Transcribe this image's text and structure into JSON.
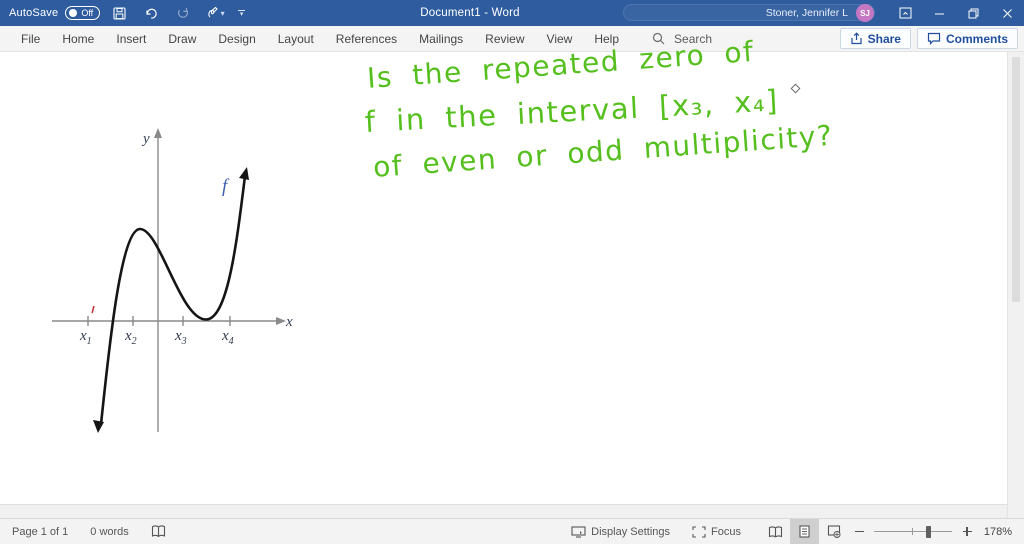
{
  "title_bar": {
    "autosave_label": "AutoSave",
    "autosave_state": "Off",
    "document_title": "Document1  -  Word",
    "user_name": "Stoner, Jennifer L",
    "user_initials": "SJ"
  },
  "ribbon": {
    "tabs": [
      "File",
      "Home",
      "Insert",
      "Draw",
      "Design",
      "Layout",
      "References",
      "Mailings",
      "Review",
      "View",
      "Help"
    ],
    "search_label": "Search",
    "share_label": "Share",
    "comments_label": "Comments"
  },
  "document": {
    "ink_lines": [
      "Is the repeated zero of",
      "f in the interval [x₃, x₄]",
      "of even or odd multiplicity?"
    ],
    "figure": {
      "description": "Graph of a polynomial f: rises from lower left crossing x-axis between x1 and x2, local maximum above x2, touches x-axis (repeated zero) between x3 and x4, then rises steeply",
      "y_axis_label": "y",
      "x_axis_label": "x",
      "curve_label": "f",
      "ticks": [
        {
          "base": "x",
          "sub": "1"
        },
        {
          "base": "x",
          "sub": "2"
        },
        {
          "base": "x",
          "sub": "3"
        },
        {
          "base": "x",
          "sub": "4"
        }
      ]
    }
  },
  "status_bar": {
    "page_indicator": "Page 1 of 1",
    "word_count": "0 words",
    "display_settings_label": "Display Settings",
    "focus_label": "Focus",
    "zoom_level": "178%"
  },
  "icons": {
    "quick_access": [
      "save-icon",
      "undo-icon",
      "redo-icon",
      "ink-pen-icon",
      "customize-toolbar-chevron"
    ],
    "window": [
      "ribbon-display-options-icon",
      "minimize-icon",
      "restore-icon",
      "close-icon"
    ],
    "status": [
      "proofing-book-icon",
      "display-settings-icon",
      "focus-icon",
      "read-mode-icon",
      "print-layout-icon",
      "web-layout-icon"
    ]
  },
  "colors": {
    "title_bar_blue": "#2e5c9e",
    "ink_green": "#55bf1e",
    "accent_blue": "#1f4e9c",
    "axis_gray": "#8a8a8a",
    "curve_black": "#151515",
    "f_label_blue": "#3f5fae",
    "red_mark": "#c23b3b",
    "avatar_pink": "#c478c4"
  }
}
